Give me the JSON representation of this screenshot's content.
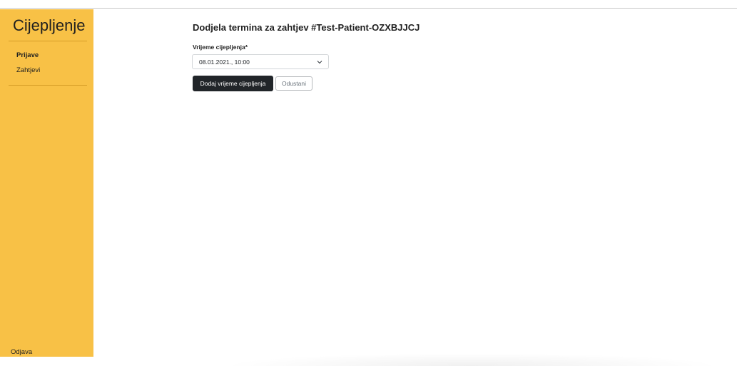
{
  "sidebar": {
    "brand": "Cijepljenje",
    "items": [
      {
        "label": "Prijave",
        "active": true
      },
      {
        "label": "Zahtjevi",
        "active": false
      }
    ],
    "logout_label": "Odjava",
    "background_color": "#f8c146"
  },
  "main": {
    "title": "Dodjela termina za zahtjev #Test-Patient-OZXBJJCJ",
    "form": {
      "field_label": "Vrijeme cijepljenja*",
      "selected_value": "08.01.2021., 10:00",
      "submit_label": "Dodaj vrijeme cijepljenja",
      "cancel_label": "Odustani"
    }
  },
  "icons": {
    "select_arrow": "chevron-down-icon"
  }
}
